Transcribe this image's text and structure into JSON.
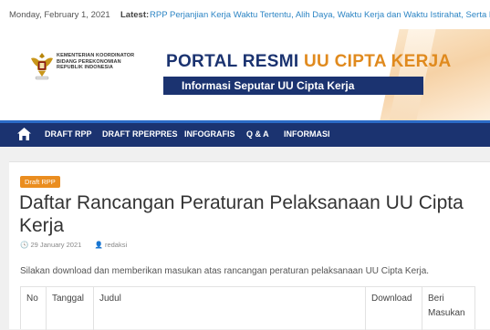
{
  "topbar": {
    "date": "Monday, February 1, 2021",
    "latest_label": "Latest:",
    "ticker": "RPP Perjanjian Kerja Waktu Tertentu, Alih Daya, Waktu Kerja dan Waktu Istirahat, Serta Pem"
  },
  "header": {
    "ministry_line1": "KEMENTERIAN KOORDINATOR",
    "ministry_line2": "BIDANG PEREKONOMIAN",
    "ministry_line3": "REPUBLIK INDONESIA",
    "title_main": "PORTAL RESMI",
    "title_accent": "UU CIPTA KERJA",
    "subtitle": "Informasi Seputar UU Cipta Kerja"
  },
  "nav": {
    "items": [
      "DRAFT RPP",
      "DRAFT RPERPRES",
      "INFOGRAFIS",
      "Q & A",
      "INFORMASI"
    ]
  },
  "post": {
    "category": "Draft RPP",
    "title": "Daftar Rancangan Peraturan Pelaksanaan UU Cipta Kerja",
    "date": "29 January 2021",
    "author": "redaksi",
    "intro": "Silakan download dan memberikan masukan atas rancangan peraturan pelaksanaan UU Cipta Kerja."
  },
  "table": {
    "headers": [
      "No",
      "Tanggal",
      "Judul",
      "Download",
      "Beri Masukan"
    ]
  },
  "colors": {
    "navy": "#1b3370",
    "accent_orange": "#e08a1e",
    "link_blue": "#2d85c4"
  }
}
